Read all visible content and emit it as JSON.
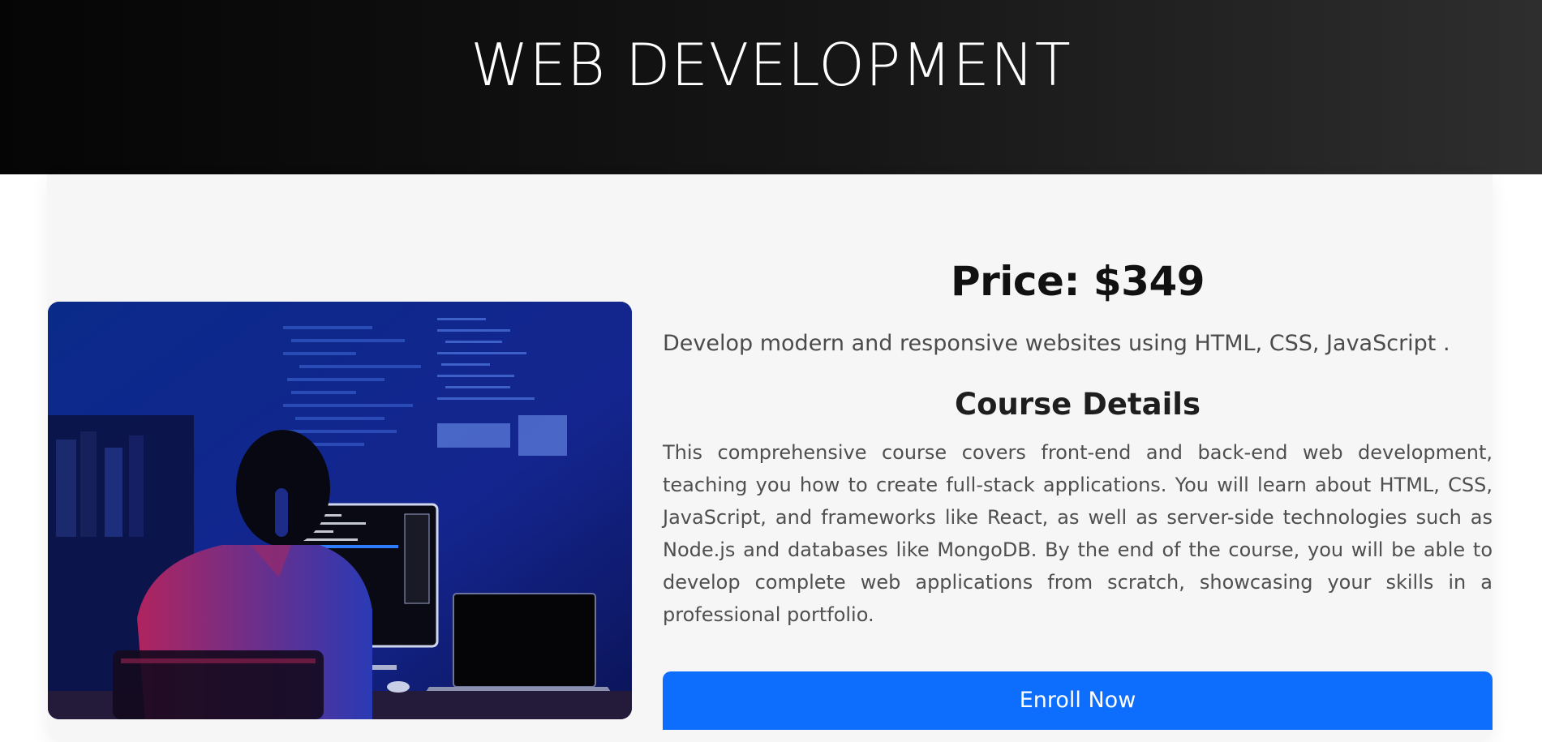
{
  "header": {
    "title": "WEB DEVELOPMENT"
  },
  "course": {
    "price": "Price: $349",
    "tagline": "Develop modern and responsive websites using HTML, CSS, JavaScript .",
    "details_heading": "Course Details",
    "details_body": "This comprehensive course covers front-end and back-end web development, teaching you how to create full-stack applications. You will learn about HTML, CSS, JavaScript, and frameworks like React, as well as server-side technologies such as Node.js and databases like MongoDB. By the end of the course, you will be able to develop complete web applications from scratch, showcasing your skills in a professional portfolio.",
    "enroll_label": "Enroll Now"
  },
  "colors": {
    "header_bg": "#111111",
    "card_bg": "#f6f6f7",
    "accent": "#0d6efd",
    "image_blue": "#0f1f76"
  },
  "icons": {
    "course_image": "developer-at-computer-image"
  }
}
